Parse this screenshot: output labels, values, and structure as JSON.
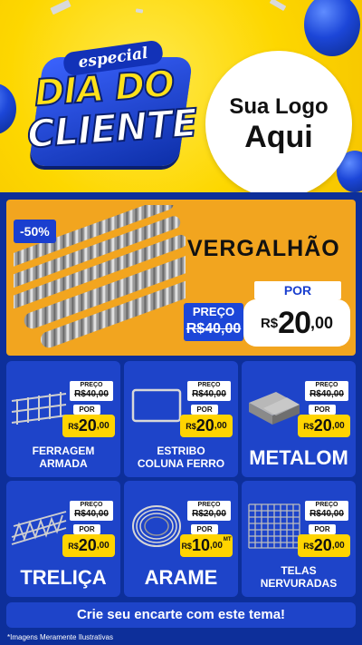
{
  "header": {
    "badge": {
      "special": "especial",
      "line1": "DIA DO",
      "line2": "CLIENTE"
    },
    "logo": {
      "line1": "Sua Logo",
      "line2": "Aqui"
    }
  },
  "hero": {
    "discount": "-50%",
    "title": "VERGALHÃO",
    "preco_label": "PREÇO",
    "old_price": "R$40,00",
    "por_label": "POR",
    "price_currency": "R$",
    "price_int": "20",
    "price_cents": ",00"
  },
  "products": [
    {
      "name": "FERRAGEM ARMADA",
      "preco_label": "PREÇO",
      "old_price": "R$40,00",
      "por_label": "POR",
      "currency": "R$",
      "int": "20",
      "cents": ",00",
      "unit": ""
    },
    {
      "name": "ESTRIBO COLUNA FERRO",
      "preco_label": "PREÇO",
      "old_price": "R$40,00",
      "por_label": "POR",
      "currency": "R$",
      "int": "20",
      "cents": ",00",
      "unit": ""
    },
    {
      "name": "METALOM",
      "preco_label": "PREÇO",
      "old_price": "R$40,00",
      "por_label": "POR",
      "currency": "R$",
      "int": "20",
      "cents": ",00",
      "unit": ""
    },
    {
      "name": "TRELIÇA",
      "preco_label": "PREÇO",
      "old_price": "R$40,00",
      "por_label": "POR",
      "currency": "R$",
      "int": "20",
      "cents": ",00",
      "unit": ""
    },
    {
      "name": "ARAME",
      "preco_label": "PREÇO",
      "old_price": "R$20,00",
      "por_label": "POR",
      "currency": "R$",
      "int": "10",
      "cents": ",00",
      "unit": "MT"
    },
    {
      "name": "TELAS NERVURADAS",
      "preco_label": "PREÇO",
      "old_price": "R$40,00",
      "por_label": "POR",
      "currency": "R$",
      "int": "20",
      "cents": ",00",
      "unit": ""
    }
  ],
  "footer": {
    "cta": "Crie seu encarte com este tema!",
    "disclaimer": "*Imagens Meramente Ilustrativas"
  },
  "colors": {
    "blue": "#1e44c9",
    "yellow": "#ffd400",
    "orange": "#f2a51f",
    "navy": "#0d2f9a"
  }
}
